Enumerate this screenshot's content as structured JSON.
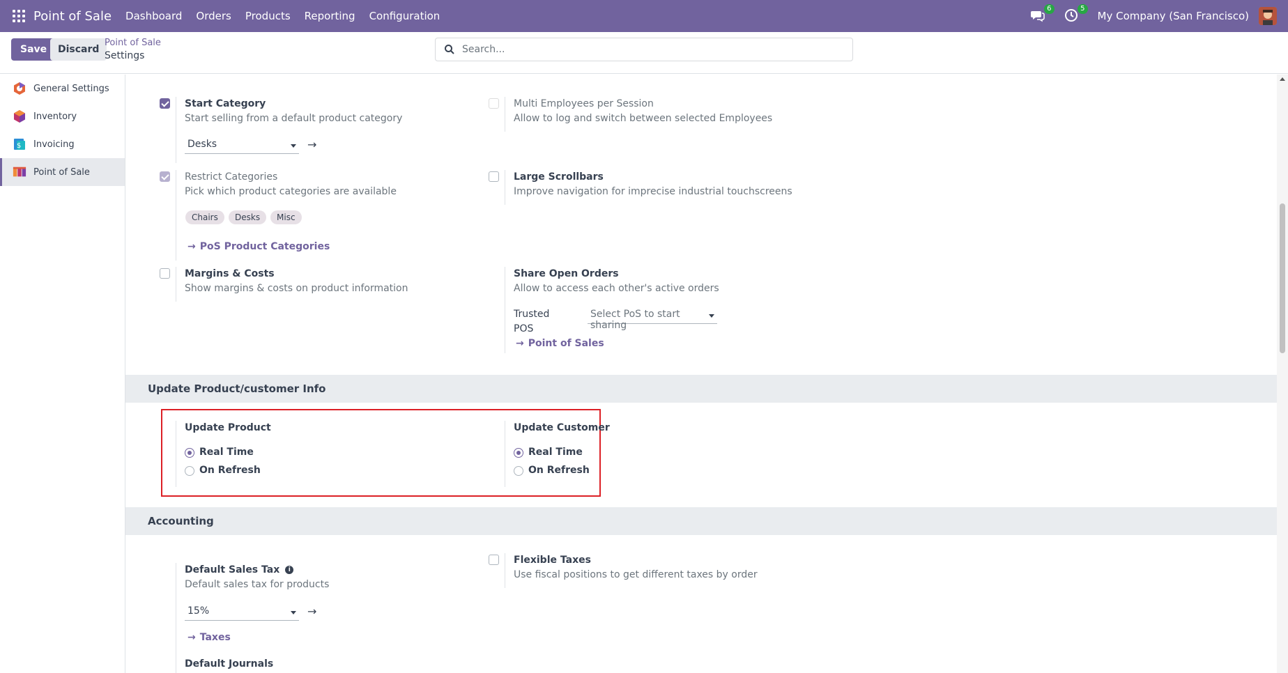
{
  "navbar": {
    "brand": "Point of Sale",
    "menu": [
      "Dashboard",
      "Orders",
      "Products",
      "Reporting",
      "Configuration"
    ],
    "messages_count": "6",
    "activities_count": "5",
    "company": "My Company (San Francisco)"
  },
  "control_panel": {
    "save_label": "Save",
    "discard_label": "Discard",
    "breadcrumb_parent": "Point of Sale",
    "breadcrumb_current": "Settings",
    "search_placeholder": "Search..."
  },
  "sidebar": {
    "items": [
      {
        "label": "General Settings",
        "icon": "general-settings-icon"
      },
      {
        "label": "Inventory",
        "icon": "inventory-icon"
      },
      {
        "label": "Invoicing",
        "icon": "invoicing-icon"
      },
      {
        "label": "Point of Sale",
        "icon": "point-of-sale-icon"
      }
    ]
  },
  "settings": {
    "start_category": {
      "title": "Start Category",
      "desc": "Start selling from a default product category",
      "value": "Desks",
      "checked": true
    },
    "multi_employees": {
      "title": "Multi Employees per Session",
      "desc": "Allow to log and switch between selected Employees",
      "checked": false
    },
    "restrict_categories": {
      "title": "Restrict Categories",
      "desc": "Pick which product categories are available",
      "tags": [
        "Chairs",
        "Desks",
        "Misc"
      ],
      "link": "PoS Product Categories",
      "checked": true
    },
    "large_scrollbars": {
      "title": "Large Scrollbars",
      "desc": "Improve navigation for imprecise industrial touchscreens",
      "checked": false
    },
    "margins_costs": {
      "title": "Margins & Costs",
      "desc": "Show margins & costs on product information",
      "checked": false
    },
    "share_open_orders": {
      "title": "Share Open Orders",
      "desc": "Allow to access each other's active orders",
      "trusted_label_1": "Trusted",
      "trusted_label_2": "POS",
      "trusted_placeholder": "Select PoS to start sharing",
      "link": "Point of Sales"
    }
  },
  "update_section": {
    "header": "Update Product/customer Info",
    "product": {
      "title": "Update Product",
      "options": [
        "Real Time",
        "On Refresh"
      ],
      "selected": "Real Time"
    },
    "customer": {
      "title": "Update Customer",
      "options": [
        "Real Time",
        "On Refresh"
      ],
      "selected": "Real Time"
    }
  },
  "accounting": {
    "header": "Accounting",
    "default_sales_tax": {
      "title": "Default Sales Tax",
      "desc": "Default sales tax for products",
      "value": "15%",
      "link": "Taxes"
    },
    "flexible_taxes": {
      "title": "Flexible Taxes",
      "desc": "Use fiscal positions to get different taxes by order",
      "checked": false
    },
    "default_journals": {
      "title": "Default Journals"
    }
  },
  "colors": {
    "primary": "#71639e",
    "highlight": "#dc2026"
  }
}
